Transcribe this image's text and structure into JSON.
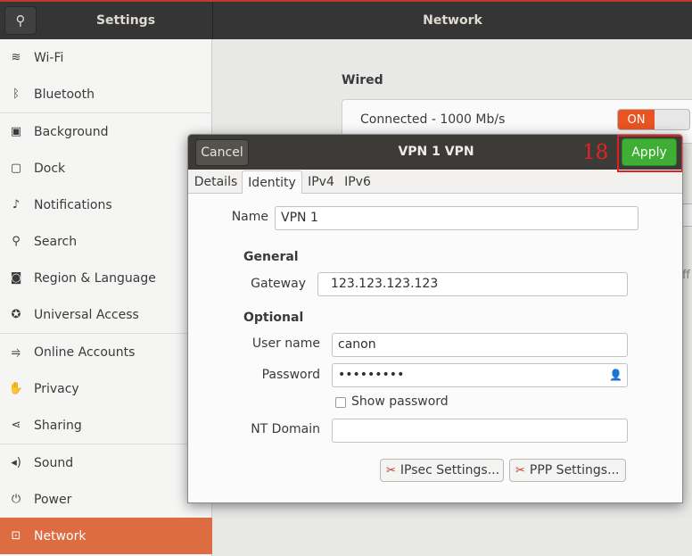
{
  "header": {
    "left_title": "Settings",
    "right_title": "Network"
  },
  "sidebar": {
    "items": [
      {
        "label": "Wi-Fi",
        "icon": "wifi-icon",
        "glyph": "≋"
      },
      {
        "label": "Bluetooth",
        "icon": "bluetooth-icon",
        "glyph": "ᛒ"
      },
      {
        "label": "Background",
        "icon": "background-icon",
        "glyph": "▣"
      },
      {
        "label": "Dock",
        "icon": "dock-icon",
        "glyph": "▢"
      },
      {
        "label": "Notifications",
        "icon": "bell-icon",
        "glyph": "♪"
      },
      {
        "label": "Search",
        "icon": "search-icon",
        "glyph": "⚲"
      },
      {
        "label": "Region & Language",
        "icon": "camera-icon",
        "glyph": "◙"
      },
      {
        "label": "Universal Access",
        "icon": "accessibility-icon",
        "glyph": "✪"
      },
      {
        "label": "Online Accounts",
        "icon": "online-accounts-icon",
        "glyph": "⥤"
      },
      {
        "label": "Privacy",
        "icon": "hand-icon",
        "glyph": "✋"
      },
      {
        "label": "Sharing",
        "icon": "share-icon",
        "glyph": "⋖"
      },
      {
        "label": "Sound",
        "icon": "speaker-icon",
        "glyph": "◂)"
      },
      {
        "label": "Power",
        "icon": "power-icon",
        "glyph": "⏻"
      },
      {
        "label": "Network",
        "icon": "network-icon",
        "glyph": "⊡"
      }
    ],
    "active": "Network"
  },
  "main": {
    "wired_title": "Wired",
    "wired_status": "Connected - 1000 Mb/s",
    "toggle_on": "ON",
    "fragment_text": "ff"
  },
  "dialog": {
    "title": "VPN 1 VPN",
    "cancel_label": "Cancel",
    "apply_label": "Apply",
    "annotation": "18",
    "tabs": [
      "Details",
      "Identity",
      "IPv4",
      "IPv6"
    ],
    "active_tab": "Identity",
    "name_label": "Name",
    "name_value": "VPN 1",
    "general_heading": "General",
    "gateway_label": "Gateway",
    "gateway_value": "123.123.123.123",
    "optional_heading": "Optional",
    "username_label": "User name",
    "username_value": "canon",
    "password_label": "Password",
    "password_value": "•••••••••",
    "show_password_label": "Show password",
    "nt_domain_label": "NT Domain",
    "nt_domain_value": "",
    "ipsec_button": "IPsec Settings...",
    "ppp_button": "PPP Settings..."
  },
  "colors": {
    "accent": "#e95420",
    "apply_green": "#3fae35",
    "annotation_red": "#e02020"
  }
}
